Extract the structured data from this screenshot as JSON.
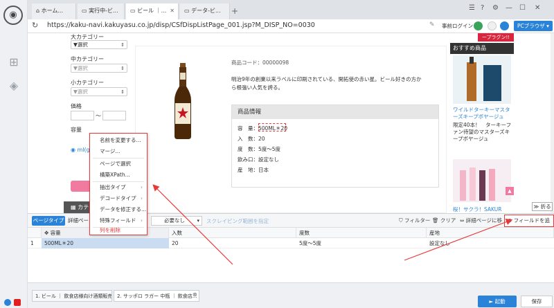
{
  "browser": {
    "tabs": [
      {
        "label": "ホーム..."
      },
      {
        "label": "実行中-ビ..."
      },
      {
        "label": "ビール ｜..."
      },
      {
        "label": "データ-ビ..."
      }
    ],
    "url": "https://kaku-navi.kakuyasu.co.jp/disp/CSfDispListPage_001.jsp?M_DISP_NO=0030",
    "login_text": "事前ログイン",
    "pc_browser_label": "PCブラウザ ▾"
  },
  "sidebar": {
    "large_category_label": "大カテゴリー",
    "large_category_value": "▼選択",
    "mid_category_label": "中カテゴリー",
    "mid_category_value": "▼選択",
    "small_category_label": "小カテゴリー",
    "small_category_value": "▼選択",
    "price_label": "価格",
    "price_sep": "〜",
    "capacity_label": "容量",
    "radio_text": "ml(g",
    "category_bar": "カテ"
  },
  "product": {
    "code": "商品コード：00000098",
    "description": "明治9年の創業以来ラベルに印刷されている、開拓使の赤い星。ビール好きの方から根強い人気を誇る。",
    "info_title": "商品情報",
    "info_rows": [
      "容　量：500ML＊20",
      "入　数：20",
      "度　数：5度〜5度",
      "飲み口：設定なし",
      "産　地：日本"
    ]
  },
  "recommend": {
    "banner": "ープラグン!!",
    "title": "おすすめ商品",
    "item1_name": "ワイルドターキーマスターズキープボヤージュ",
    "item1_sub": "限定40本！　ターキーファン待望のマスターズキープボヤージュ",
    "item2_name": "桜！サクラ！SAKUR"
  },
  "context_menu": {
    "items": [
      {
        "label": "名前を変更する..."
      },
      {
        "label": "マージ..."
      },
      {
        "label": "ページで選択"
      },
      {
        "label": "構築XPath..."
      },
      {
        "label": "抽出タイプ"
      },
      {
        "label": "デコードタイプ"
      },
      {
        "label": "データを修正する..."
      },
      {
        "label": "特殊フィールド"
      },
      {
        "label": "列を削除"
      }
    ]
  },
  "panel": {
    "page_type": "ページタイプ",
    "detail": "詳細ペー",
    "need_select": "必要なし",
    "scrape_range": "スクレイピング範囲を指定",
    "filter": "フィルター",
    "clear": "クリア",
    "detail_page_link": "詳細ページに移",
    "add_field": "フィールドを追加",
    "collapse": "折る",
    "columns": [
      "容量",
      "入数",
      "度数",
      "産地"
    ],
    "row": {
      "num": "1",
      "capacity": "500ML＊20",
      "count": "20",
      "degree": "5度〜5度",
      "origin": "設定なし"
    }
  },
  "taskbar": {
    "tabs": [
      {
        "label": "1. ビール ｜ 飲食店様向け酒類販売..."
      },
      {
        "label": "2. サッポロ ラガー 中瓶 ｜ 飲食店..."
      }
    ],
    "start": "► 起動",
    "save": "保存"
  },
  "colors": {
    "accent": "#2a83d7",
    "highlight": "#e53a3a",
    "pink": "#f07aa0"
  }
}
